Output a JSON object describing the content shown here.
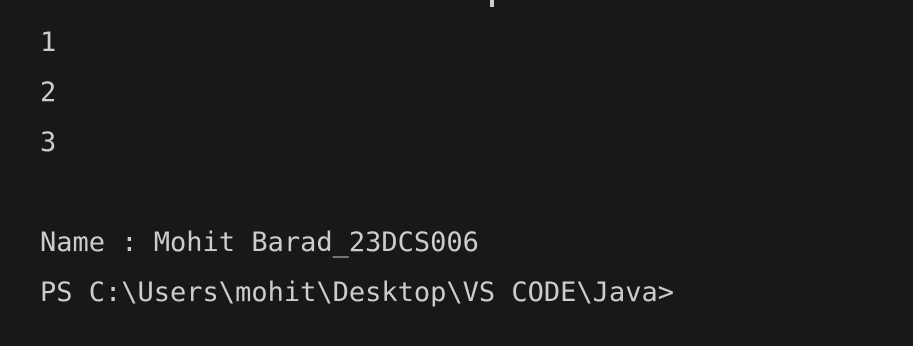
{
  "terminal": {
    "lines": [
      "1",
      "2",
      "3",
      "",
      "Name : Mohit Barad_23DCS006",
      "PS C:\\Users\\mohit\\Desktop\\VS CODE\\Java>"
    ],
    "colors": {
      "background": "#181818",
      "text": "#cccccc"
    }
  }
}
